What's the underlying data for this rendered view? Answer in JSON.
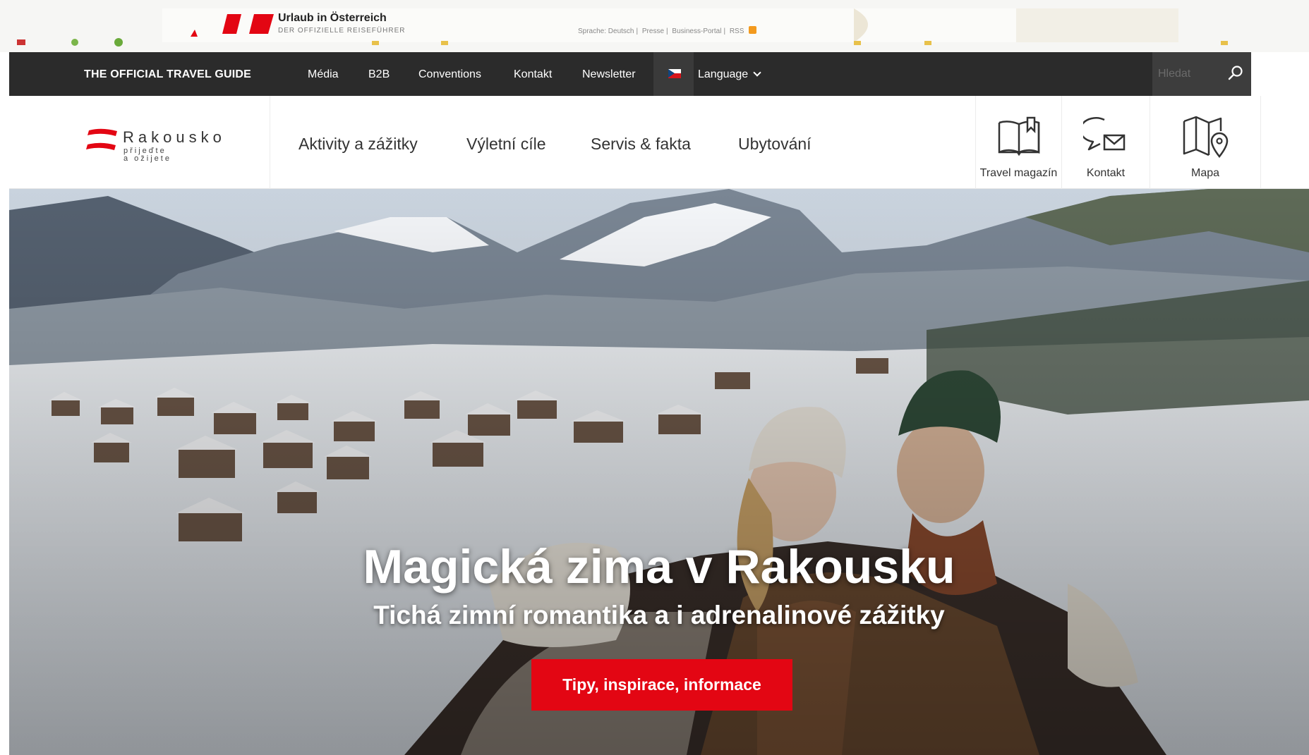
{
  "legacy_banner": {
    "logo_title": "Urlaub in Österreich",
    "logo_subtitle": "DER OFFIZIELLE REISEFÜHRER",
    "links": [
      "Sprache: Deutsch",
      "Presse",
      "Business-Portal",
      "RSS"
    ]
  },
  "topbar": {
    "guide_label": "THE OFFICIAL TRAVEL GUIDE",
    "links": [
      "Média",
      "B2B",
      "Conventions",
      "Kontakt",
      "Newsletter"
    ],
    "language_label": "Language",
    "search_placeholder": "Hledat"
  },
  "brand": {
    "name": "Rakousko",
    "tagline_line1": "přijeďte",
    "tagline_line2": "a ožijete"
  },
  "main_nav": {
    "items": [
      "Aktivity a zážitky",
      "Výletní cíle",
      "Servis & fakta",
      "Ubytování"
    ]
  },
  "utility_nav": [
    {
      "label": "Travel magazín",
      "icon": "book-icon"
    },
    {
      "label": "Kontakt",
      "icon": "chat-mail-icon"
    },
    {
      "label": "Mapa",
      "icon": "map-pin-icon"
    }
  ],
  "hero": {
    "title": "Magická zima v Rakousku",
    "subtitle": "Tichá zimní romantika a i adrenalinové zážitky",
    "cta_label": "Tipy, inspirace, informace"
  },
  "colors": {
    "accent_red": "#e30613",
    "topbar_bg": "#2b2b2b"
  }
}
